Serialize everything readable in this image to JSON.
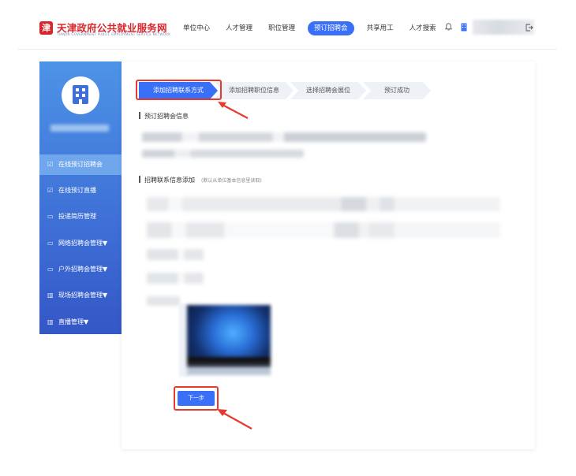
{
  "header": {
    "logo_char": "津",
    "logo_title": "天津政府公共就业服务网",
    "logo_subtitle": "TIANJIN GOVERNMENT PUBLIC EMPLOYMENT SERVICE NETWORK",
    "nav": [
      "单位中心",
      "人才管理",
      "职位管理",
      "预订招聘会",
      "共享用工",
      "人才搜索"
    ],
    "nav_active_index": 3,
    "icons": [
      "bell-icon",
      "building-icon",
      "logout-icon"
    ]
  },
  "sidebar": {
    "items": [
      {
        "label": "在线预订招聘会",
        "icon": "☑",
        "active": true
      },
      {
        "label": "在线预订直播",
        "icon": "☑",
        "active": false
      },
      {
        "label": "投递简历管理",
        "icon": "▭",
        "active": false
      },
      {
        "label": "网络招聘会管理▼",
        "icon": "▭",
        "active": false
      },
      {
        "label": "户外招聘会管理▼",
        "icon": "▭",
        "active": false
      },
      {
        "label": "现场招聘会管理▼",
        "icon": "▥",
        "active": false
      },
      {
        "label": "直播管理▼",
        "icon": "▥",
        "active": false
      }
    ]
  },
  "steps": [
    "添加招聘联系方式",
    "添加招聘职位信息",
    "选择招聘会展位",
    "预订成功"
  ],
  "section1": {
    "title": "预订招聘会信息"
  },
  "section2": {
    "title": "招聘联系信息添加",
    "hint": "(默认从单位基本信息里读取)"
  },
  "buttons": {
    "next": "下一步"
  },
  "colors": {
    "primary": "#3a6ff7",
    "sidebar_top": "#4d93e6",
    "sidebar_bottom": "#3457c6",
    "brand_red": "#d9262d",
    "annotation_red": "#e63a2e"
  }
}
